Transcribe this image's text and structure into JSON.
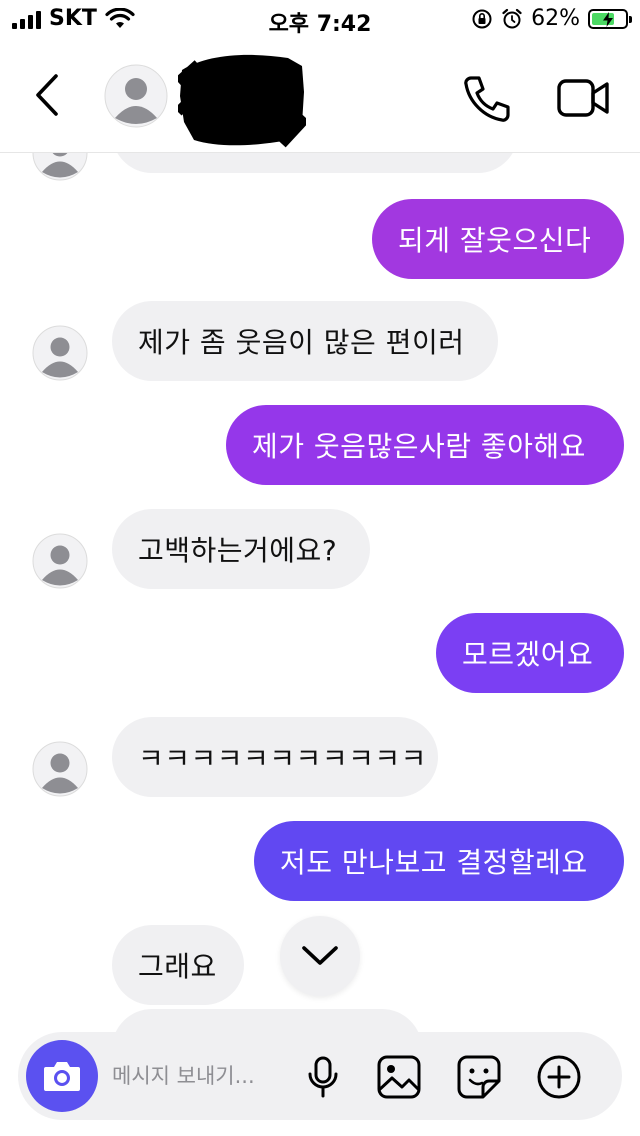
{
  "status_bar": {
    "carrier": "SKT",
    "time": "오후 7:42",
    "battery": "62%"
  },
  "header": {
    "back_icon": "chevron-left-icon",
    "avatar_icon": "default-avatar-icon",
    "call_icon": "phone-icon",
    "video_icon": "video-camera-icon"
  },
  "messages": [
    {
      "side": "in",
      "text": ""
    },
    {
      "side": "out",
      "text": "되게 잘웃으신다"
    },
    {
      "side": "in",
      "text": "제가 좀 웃음이 많은 편이러"
    },
    {
      "side": "out",
      "text": "제가 웃음많은사람 좋아해요"
    },
    {
      "side": "in",
      "text": "고백하는거에요?"
    },
    {
      "side": "out",
      "text": "모르겠어요"
    },
    {
      "side": "in",
      "text": "ㅋㅋㅋㅋㅋㅋㅋㅋㅋㅋㅋ"
    },
    {
      "side": "out",
      "text": "저도 만나보고 결정할레요"
    },
    {
      "side": "in",
      "text": "그래요"
    },
    {
      "side": "in",
      "text": ""
    }
  ],
  "colors": {
    "out_bubble_top": "#a238e0",
    "out_bubble_mid": "#8c3cf2",
    "out_bubble_bottom": "#6148f2",
    "in_bubble": "#f0f0f2",
    "camera_button": "#5b51f0",
    "battery_fill": "#4cd964"
  },
  "composer": {
    "placeholder": "메시지 보내기...",
    "camera_icon": "camera-icon",
    "mic_icon": "microphone-icon",
    "gallery_icon": "image-icon",
    "sticker_icon": "sticker-icon",
    "more_icon": "plus-circle-icon"
  },
  "scroll_down_icon": "chevron-down-icon"
}
